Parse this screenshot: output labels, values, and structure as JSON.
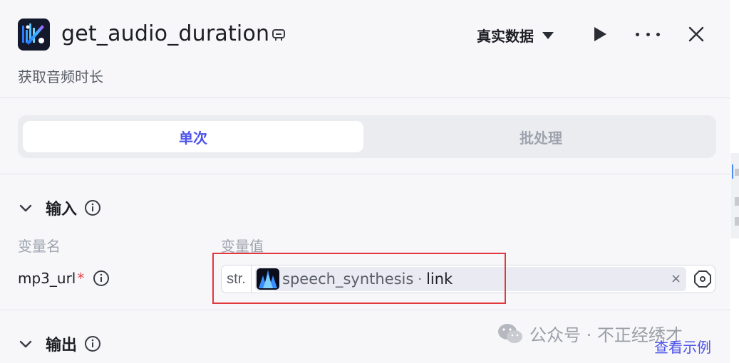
{
  "header": {
    "title": "get_audio_duration",
    "subtitle": "获取音频时长",
    "mode_label": "真实数据",
    "icons": {
      "app": "audio-node-icon",
      "edit": "edit-icon",
      "run": "play-icon",
      "more": "more-icon",
      "close": "close-icon"
    }
  },
  "tabs": [
    {
      "label": "单次",
      "active": true
    },
    {
      "label": "批处理",
      "active": false
    }
  ],
  "input": {
    "section_title": "输入",
    "col_name_label": "变量名",
    "col_value_label": "变量值",
    "variable": {
      "name": "mp3_url",
      "required_mark": "*",
      "type": "str.",
      "ref_node": "speech_synthesis",
      "ref_sep": "·",
      "ref_field": "link",
      "clear": "×"
    }
  },
  "output": {
    "section_title": "输出"
  },
  "watermark": {
    "text": "公众号 · 不正经绣才"
  },
  "example_link": "查看示例",
  "colors": {
    "accent": "#4d53e8",
    "highlight": "#e0383e",
    "required": "#e5484d"
  }
}
